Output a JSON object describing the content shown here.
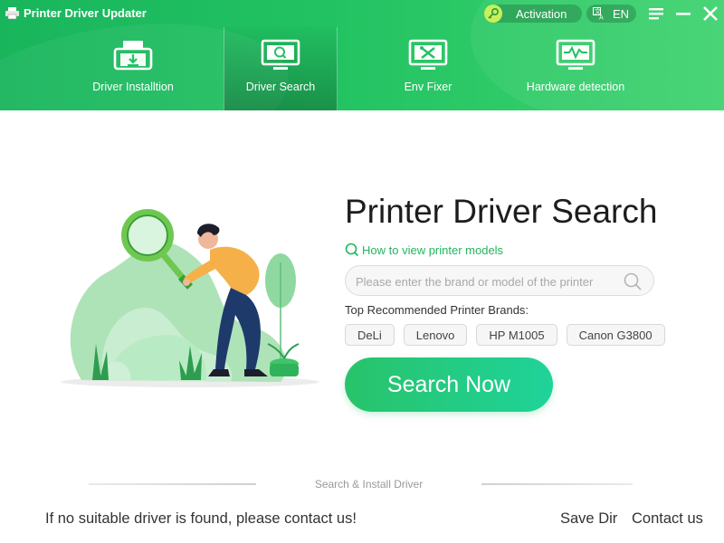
{
  "app": {
    "title": "Printer Driver Updater"
  },
  "header": {
    "activation_label": "Activation",
    "language_label": "EN",
    "tabs": [
      {
        "label": "Driver Installtion",
        "icon": "driver-install-icon",
        "active": false
      },
      {
        "label": "Driver Search",
        "icon": "driver-search-icon",
        "active": true
      },
      {
        "label": "Env Fixer",
        "icon": "env-fixer-icon",
        "active": false
      },
      {
        "label": "Hardware detection",
        "icon": "hardware-detection-icon",
        "active": false
      }
    ]
  },
  "main": {
    "title": "Printer Driver Search",
    "howto_link": "How to view printer models",
    "search": {
      "placeholder": "Please enter the brand or model of the printer",
      "value": ""
    },
    "brands_label": "Top Recommended Printer Brands:",
    "brands": [
      "DeLi",
      "Lenovo",
      "HP M1005",
      "Canon G3800"
    ],
    "search_button": "Search Now",
    "divider_text": "Search & Install Driver"
  },
  "footer": {
    "note": "If no suitable driver is found, please contact us!",
    "save_dir": "Save Dir",
    "contact": "Contact us"
  },
  "colors": {
    "header_green": "#22c262",
    "accent_green": "#23b560",
    "button_gradient_start": "#28c36a",
    "button_gradient_end": "#1fd39a"
  }
}
